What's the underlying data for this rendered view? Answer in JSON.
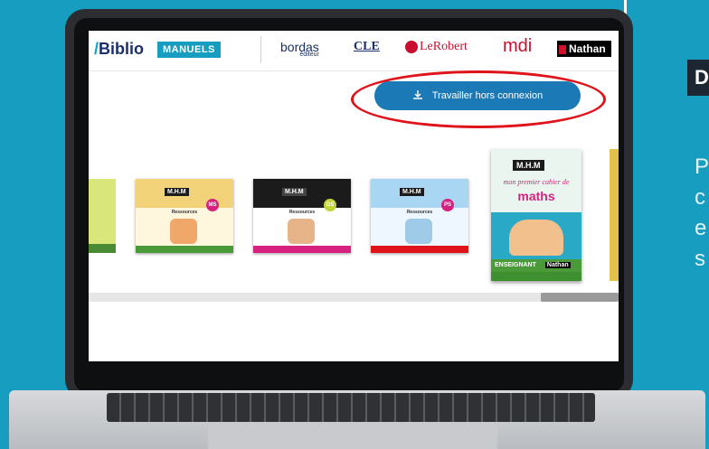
{
  "header": {
    "biblio_logo": "Biblio",
    "manuels_badge": "MANUELS",
    "brands": {
      "bordas": "bordas",
      "bordas_sub": "éditeur",
      "cle": "CLE",
      "lerobert": "LeRobert",
      "mdi": "mdi",
      "nathan": "Nathan"
    }
  },
  "offline_button": {
    "label": "Travailler hors connexion",
    "icon": "download-icon"
  },
  "annotation_color": "#e0121a",
  "covers": [
    {
      "title": "M.H.M",
      "label": "Ressources",
      "level": "MS",
      "theme": "#e8b24a"
    },
    {
      "title": "M.H.M",
      "label": "Ressources",
      "level": "GS",
      "theme": "#1b1b1b"
    },
    {
      "title": "M.H.M",
      "label": "Ressources",
      "level": "PS",
      "theme": "#8cc3ea"
    }
  ],
  "featured_cover": {
    "title": "M.H.M",
    "subtitle": "mon premier cahier de",
    "subject": "maths",
    "edition": "ENSEIGNANT",
    "publisher": "Nathan"
  },
  "side_panel": {
    "heading": "D",
    "text": "P\nc\ne\ns"
  },
  "colors": {
    "accent": "#169dbf",
    "button": "#1b79b5",
    "brand_dark": "#1a2f6b"
  }
}
